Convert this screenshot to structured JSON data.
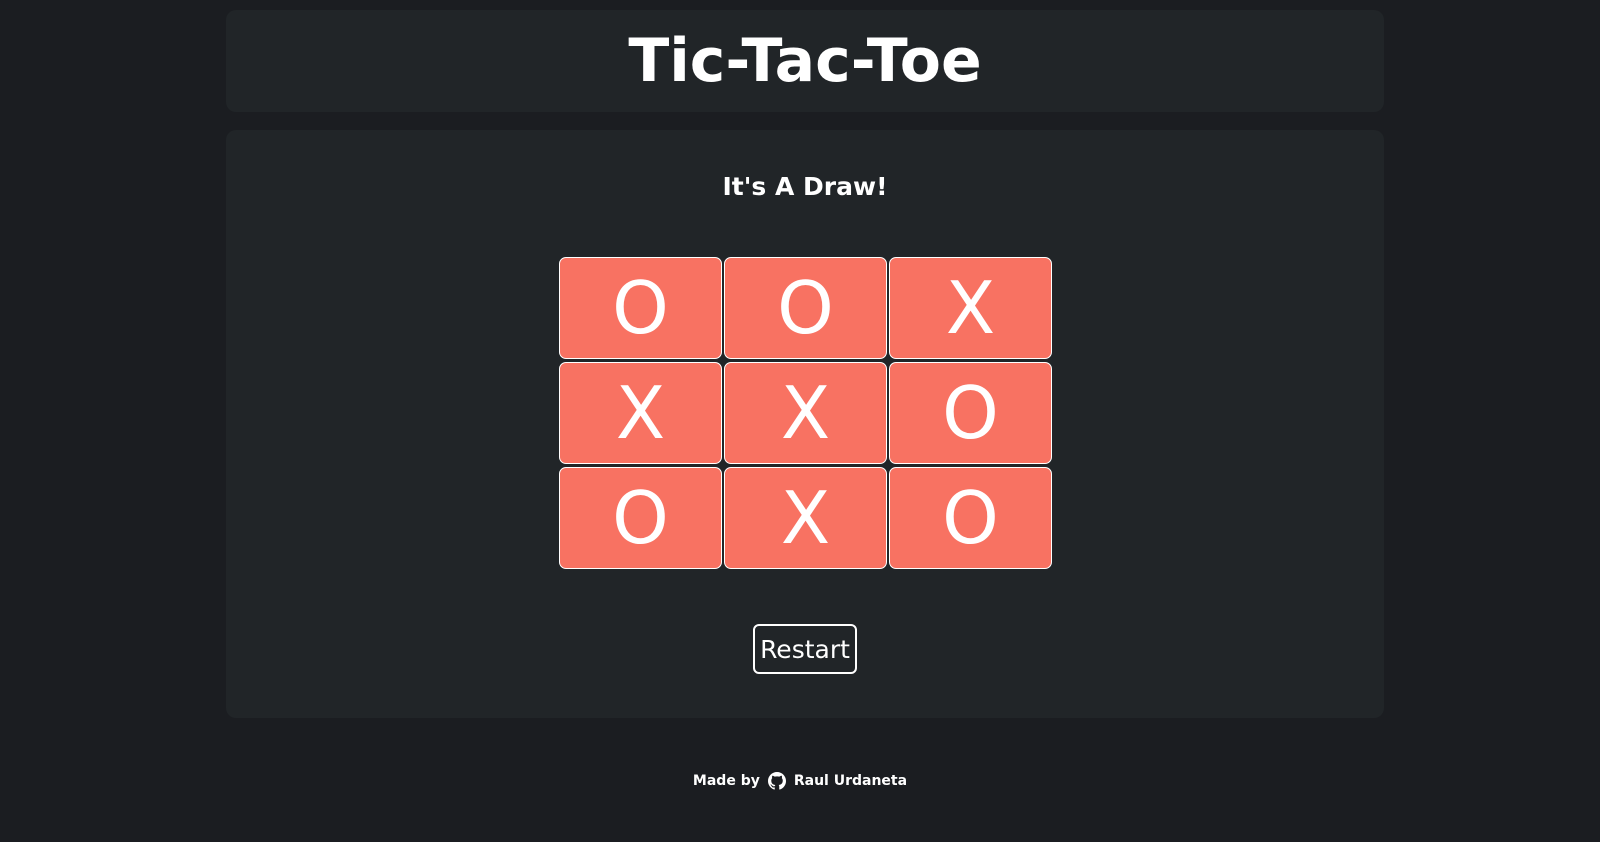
{
  "header": {
    "title": "Tic-Tac-Toe"
  },
  "game": {
    "status": "It's A Draw!",
    "board": [
      [
        "O",
        "O",
        "X"
      ],
      [
        "X",
        "X",
        "O"
      ],
      [
        "O",
        "X",
        "O"
      ]
    ],
    "restart_label": "Restart"
  },
  "footer": {
    "made_by": "Made by",
    "icon": "github-icon",
    "author": "Raul Urdaneta"
  },
  "colors": {
    "page_background": "#1b1d21",
    "card_background": "#212528",
    "cell_background": "#f87262",
    "text": "#ffffff"
  }
}
